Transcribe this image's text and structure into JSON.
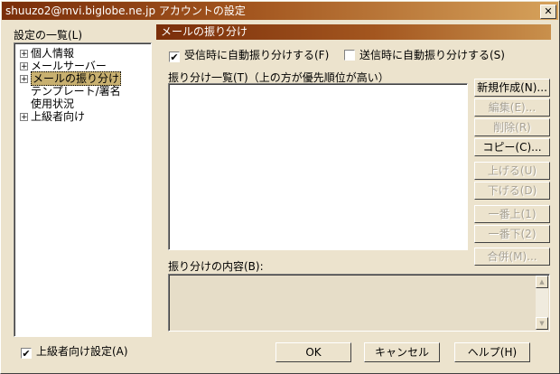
{
  "window": {
    "title": "shuuzo2@mvi.biglobe.ne.jp アカウントの設定",
    "close_label": "✕"
  },
  "tree": {
    "label": "設定の一覧(L)",
    "items": [
      {
        "label": "個人情報",
        "expander": "+"
      },
      {
        "label": "メールサーバー",
        "expander": "+"
      },
      {
        "label": "メールの振り分け",
        "expander": "+",
        "selected": true
      },
      {
        "label": "テンプレート/署名",
        "expander": ""
      },
      {
        "label": "使用状況",
        "expander": ""
      },
      {
        "label": "上級者向け",
        "expander": "+"
      }
    ]
  },
  "advanced_checkbox": {
    "label": "上級者向け設定(A)",
    "checked": true,
    "mark": "✔"
  },
  "section": {
    "title": "メールの振り分け"
  },
  "options": {
    "receive_sort": {
      "label": "受信時に自動振り分けする(F)",
      "checked": true,
      "mark": "✔"
    },
    "send_sort": {
      "label": "送信時に自動振り分けする(S)",
      "checked": false,
      "mark": ""
    }
  },
  "rules_list": {
    "label": "振り分け一覧(T)（上の方が優先順位が高い）"
  },
  "rule_buttons": {
    "new": "新規作成(N)...",
    "edit": "編集(E)...",
    "delete": "削除(R)",
    "copy": "コピー(C)...",
    "up": "上げる(U)",
    "down": "下げる(D)",
    "top": "一番上(1)",
    "bottom": "一番下(2)",
    "merge": "合併(M)..."
  },
  "content": {
    "label": "振り分けの内容(B):",
    "scroll_up": "▲",
    "scroll_down": "▼"
  },
  "dialog_buttons": {
    "ok": "OK",
    "cancel": "キャンセル",
    "help": "ヘルプ(H)"
  }
}
